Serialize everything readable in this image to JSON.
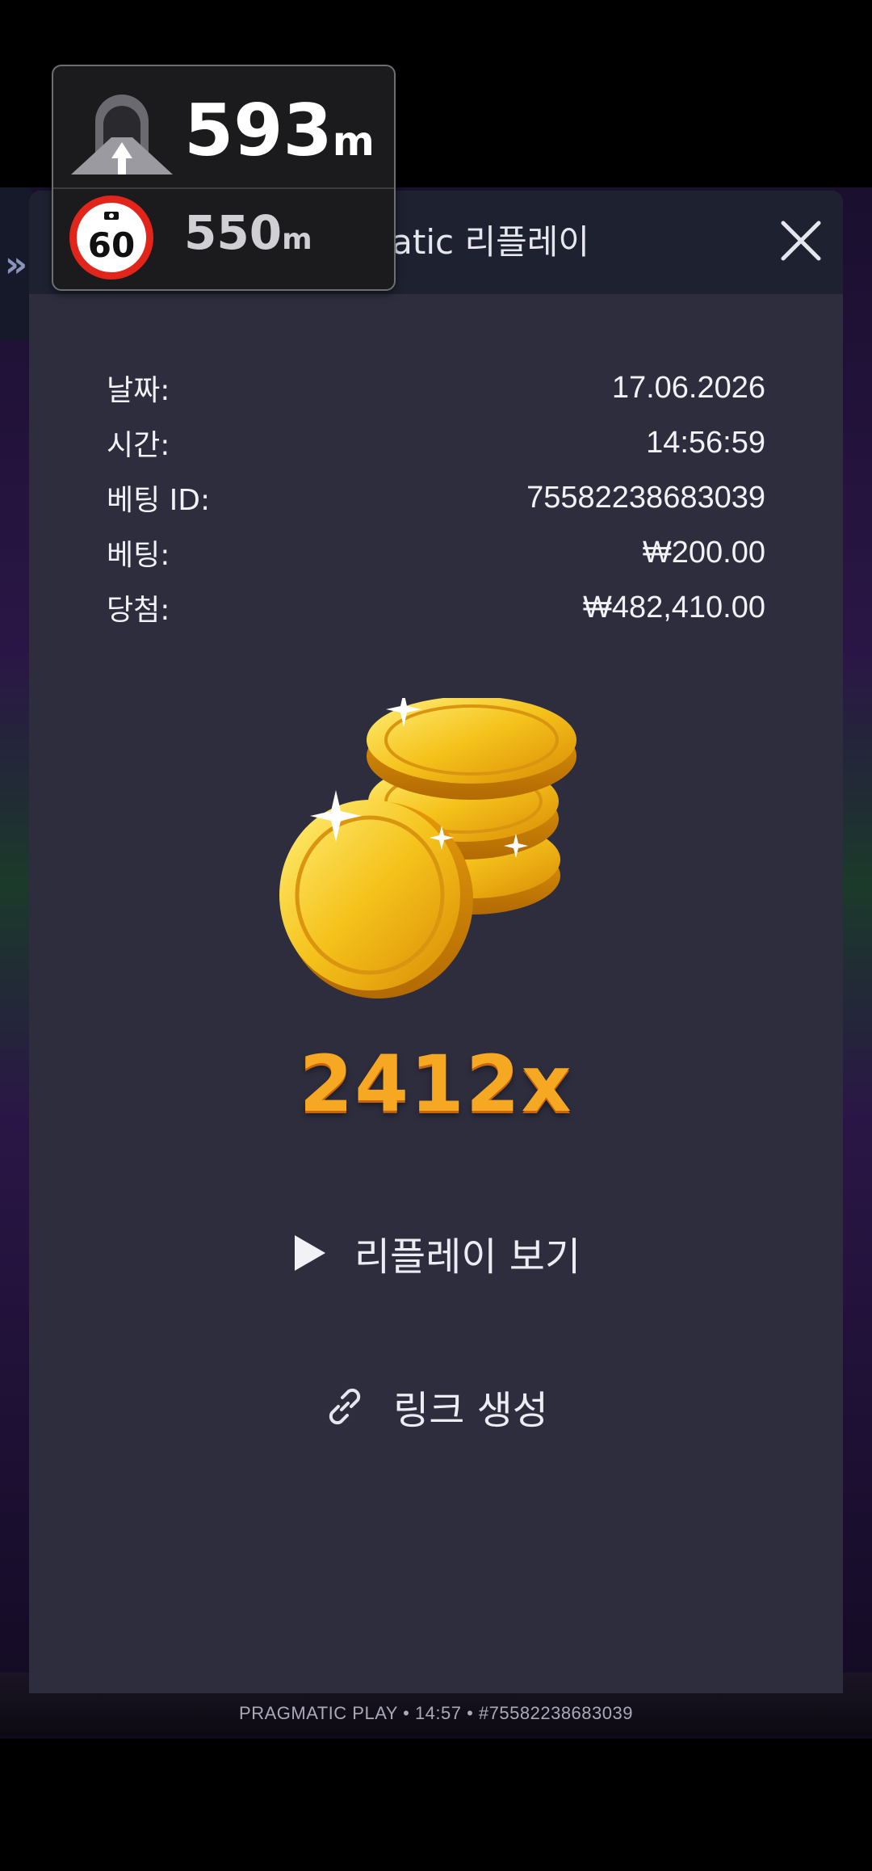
{
  "modal": {
    "title": "Pragmatic 리플레이",
    "rows": [
      {
        "label": "날짜:",
        "value": "17.06.2026"
      },
      {
        "label": "시간:",
        "value": "14:56:59"
      },
      {
        "label": "베팅 ID:",
        "value": "75582238683039"
      },
      {
        "label": "베팅:",
        "value": "₩200.00"
      },
      {
        "label": "당첨:",
        "value": "₩482,410.00"
      }
    ],
    "multiplier": "2412x",
    "replay_label": "리플레이 보기",
    "link_label": "링크 생성",
    "coins_icon": "gold-coins-icon"
  },
  "background": {
    "sidebar_glyph": "»",
    "caption": "PRAGMATIC PLAY • 14:57 • #75582238683039"
  },
  "nav_overlay": {
    "distance_value": "593",
    "distance_unit": "m",
    "speed_limit": "60",
    "camera_distance_value": "550",
    "camera_distance_unit": "m"
  },
  "colors": {
    "modal_bg": "#2d2d3e",
    "header_bg": "#1e2230",
    "multiplier": "#f7a823",
    "speed_sign_ring": "#e1251b"
  }
}
